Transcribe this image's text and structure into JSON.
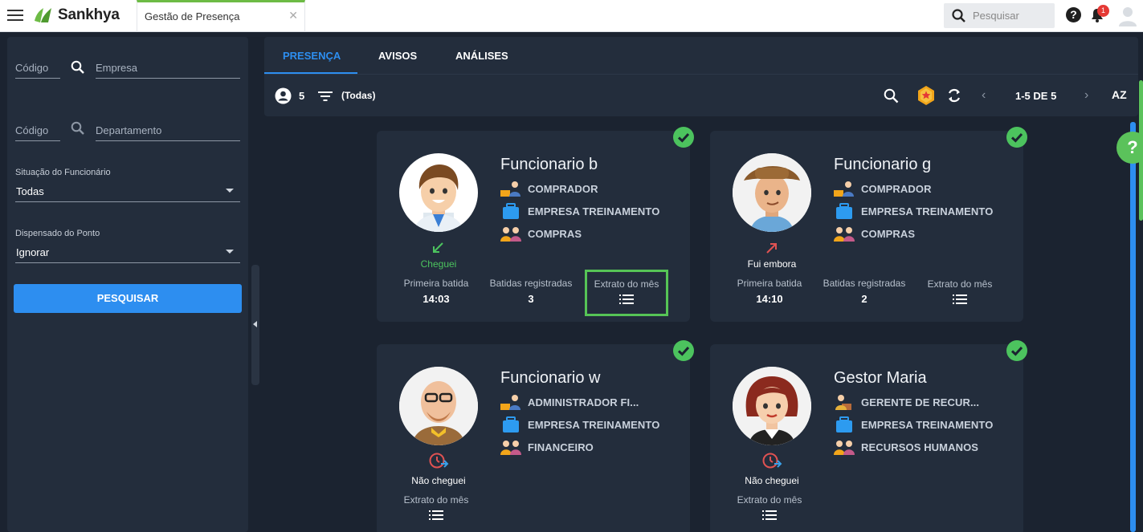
{
  "topbar": {
    "brand": "Sankhya",
    "app_tab": "Gestão de Presença",
    "search_placeholder": "Pesquisar",
    "notifications_count": "1",
    "help": "?"
  },
  "filters": {
    "empresa_codigo_label": "Código",
    "empresa_label": "Empresa",
    "departamento_codigo_label": "Código",
    "departamento_label": "Departamento",
    "situacao_label": "Situação do Funcionário",
    "situacao_value": "Todas",
    "dispensado_label": "Dispensado do Ponto",
    "dispensado_value": "Ignorar",
    "search_button": "PESQUISAR"
  },
  "main": {
    "tabs": [
      "PRESENÇA",
      "AVISOS",
      "ANÁLISES"
    ],
    "active_tab": 0,
    "employee_count": "5",
    "filter_value": "(Todas)",
    "pager": "1-5 DE 5",
    "sort_label": "AZ"
  },
  "cards": [
    {
      "name": "Funcionario b",
      "role": "COMPRADOR",
      "company": "EMPRESA TREINAMENTO",
      "department": "COMPRAS",
      "status": "Cheguei",
      "status_color": "#4cc35e",
      "first_punch_label": "Primeira batida",
      "first_punch": "14:03",
      "punches_label": "Batidas registradas",
      "punches": "3",
      "statement_label": "Extrato do mês"
    },
    {
      "name": "Funcionario g",
      "role": "COMPRADOR",
      "company": "EMPRESA TREINAMENTO",
      "department": "COMPRAS",
      "status": "Fui embora",
      "status_color": "#e05252",
      "first_punch_label": "Primeira batida",
      "first_punch": "14:10",
      "punches_label": "Batidas registradas",
      "punches": "2",
      "statement_label": "Extrato do mês"
    },
    {
      "name": "Funcionario w",
      "role": "ADMINISTRADOR FI...",
      "company": "EMPRESA TREINAMENTO",
      "department": "FINANCEIRO",
      "status": "Não cheguei",
      "statement_label": "Extrato do mês"
    },
    {
      "name": "Gestor Maria",
      "role": "GERENTE DE RECUR...",
      "company": "EMPRESA TREINAMENTO",
      "department": "RECURSOS HUMANOS",
      "status": "Não cheguei",
      "statement_label": "Extrato do mês"
    }
  ],
  "colors": {
    "accent": "#2d8ef0",
    "success": "#4cc35e",
    "danger": "#e05252",
    "panel": "#232d3c",
    "background": "#1b2330"
  }
}
